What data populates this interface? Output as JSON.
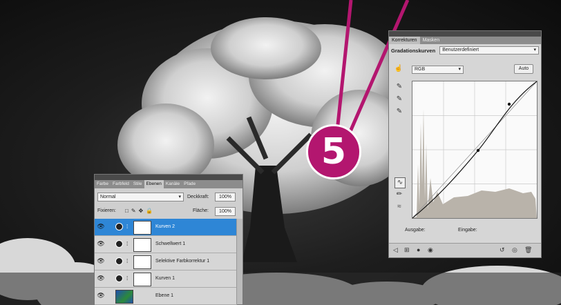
{
  "callout": {
    "number": "5",
    "color": "#b3166f"
  },
  "korrekturen": {
    "tabs": [
      {
        "label": "Korrekturen",
        "active": true
      },
      {
        "label": "Masken",
        "active": false
      }
    ],
    "adjustment_name": "Gradationskurven",
    "preset_value": "Benutzerdefiniert",
    "channel_value": "RGB",
    "auto_label": "Auto",
    "output_label": "Ausgabe:",
    "input_label": "Eingabe:"
  },
  "ebenen": {
    "tabs": [
      {
        "label": "Farbe",
        "active": false
      },
      {
        "label": "Farbfeld",
        "active": false
      },
      {
        "label": "Stile",
        "active": false
      },
      {
        "label": "Ebenen",
        "active": true
      },
      {
        "label": "Kanäle",
        "active": false
      },
      {
        "label": "Pfade",
        "active": false
      }
    ],
    "blend_mode": "Normal",
    "opacity_label": "Deckkraft:",
    "opacity_value": "100%",
    "lock_label": "Fixieren:",
    "fill_label": "Fläche:",
    "fill_value": "100%",
    "layers": [
      {
        "name": "Kurven 2",
        "type": "adjustment",
        "selected": true
      },
      {
        "name": "Schwellwert 1",
        "type": "adjustment",
        "selected": false
      },
      {
        "name": "Selektive Farbkorrektur 1",
        "type": "adjustment",
        "selected": false
      },
      {
        "name": "Kurven 1",
        "type": "adjustment",
        "selected": false
      },
      {
        "name": "Ebene 1",
        "type": "image",
        "selected": false
      }
    ]
  }
}
